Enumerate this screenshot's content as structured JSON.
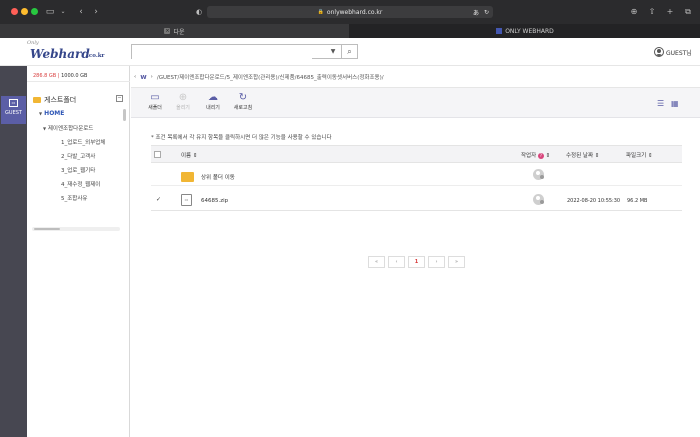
{
  "browser": {
    "url": "onlywebhard.co.kr",
    "tabs": [
      {
        "label": "다운"
      },
      {
        "label": "ONLY WEBHARD"
      }
    ]
  },
  "header": {
    "logo_small": "Only",
    "logo_main": "Webhard",
    "logo_domain": ".co.kr",
    "search_placeholder": "",
    "user_label": "GUEST님"
  },
  "rail": {
    "guest_label": "GUEST"
  },
  "panel": {
    "quota_used": "286.8 GB",
    "quota_total": "1000.0 GB",
    "root_label": "게스트폴더",
    "tree": [
      {
        "label": "HOME"
      },
      {
        "label": "제이엔조합다운로드"
      },
      {
        "label": "1_업로드_외부업체"
      },
      {
        "label": "2_다발_고객사"
      },
      {
        "label": "3_업로_웹기타"
      },
      {
        "label": "4_재수정_웹제이"
      },
      {
        "label": "5_조합사유"
      }
    ]
  },
  "main": {
    "breadcrumb": "/GUEST/제이엔조합다운로드/5_제이엔조합(관리용)/신제품/64685_출력이동셋서버스(정화조용)/",
    "toolbar": {
      "new_folder": "새폴더",
      "upload": "올리기",
      "download": "내리기",
      "refresh": "새로고침"
    },
    "notice": "* 조건 목록에서 각 유지 항목을 클릭하시면 더 많은 기능을 사용할 수 있습니다",
    "columns": {
      "name": "이름",
      "author": "작업자",
      "modified": "수정된 날짜",
      "size": "파일크기"
    },
    "rows": [
      {
        "name": "상위 폴더 이동",
        "type": "parent",
        "modified": "",
        "size": ""
      },
      {
        "name": "64685.zip",
        "type": "file",
        "checked": true,
        "modified": "2022-08-20 10:55:30",
        "size": "96.2 MB"
      }
    ],
    "pager": {
      "first": "«",
      "prev": "‹",
      "current": "1",
      "next": "›",
      "last": "»"
    }
  }
}
